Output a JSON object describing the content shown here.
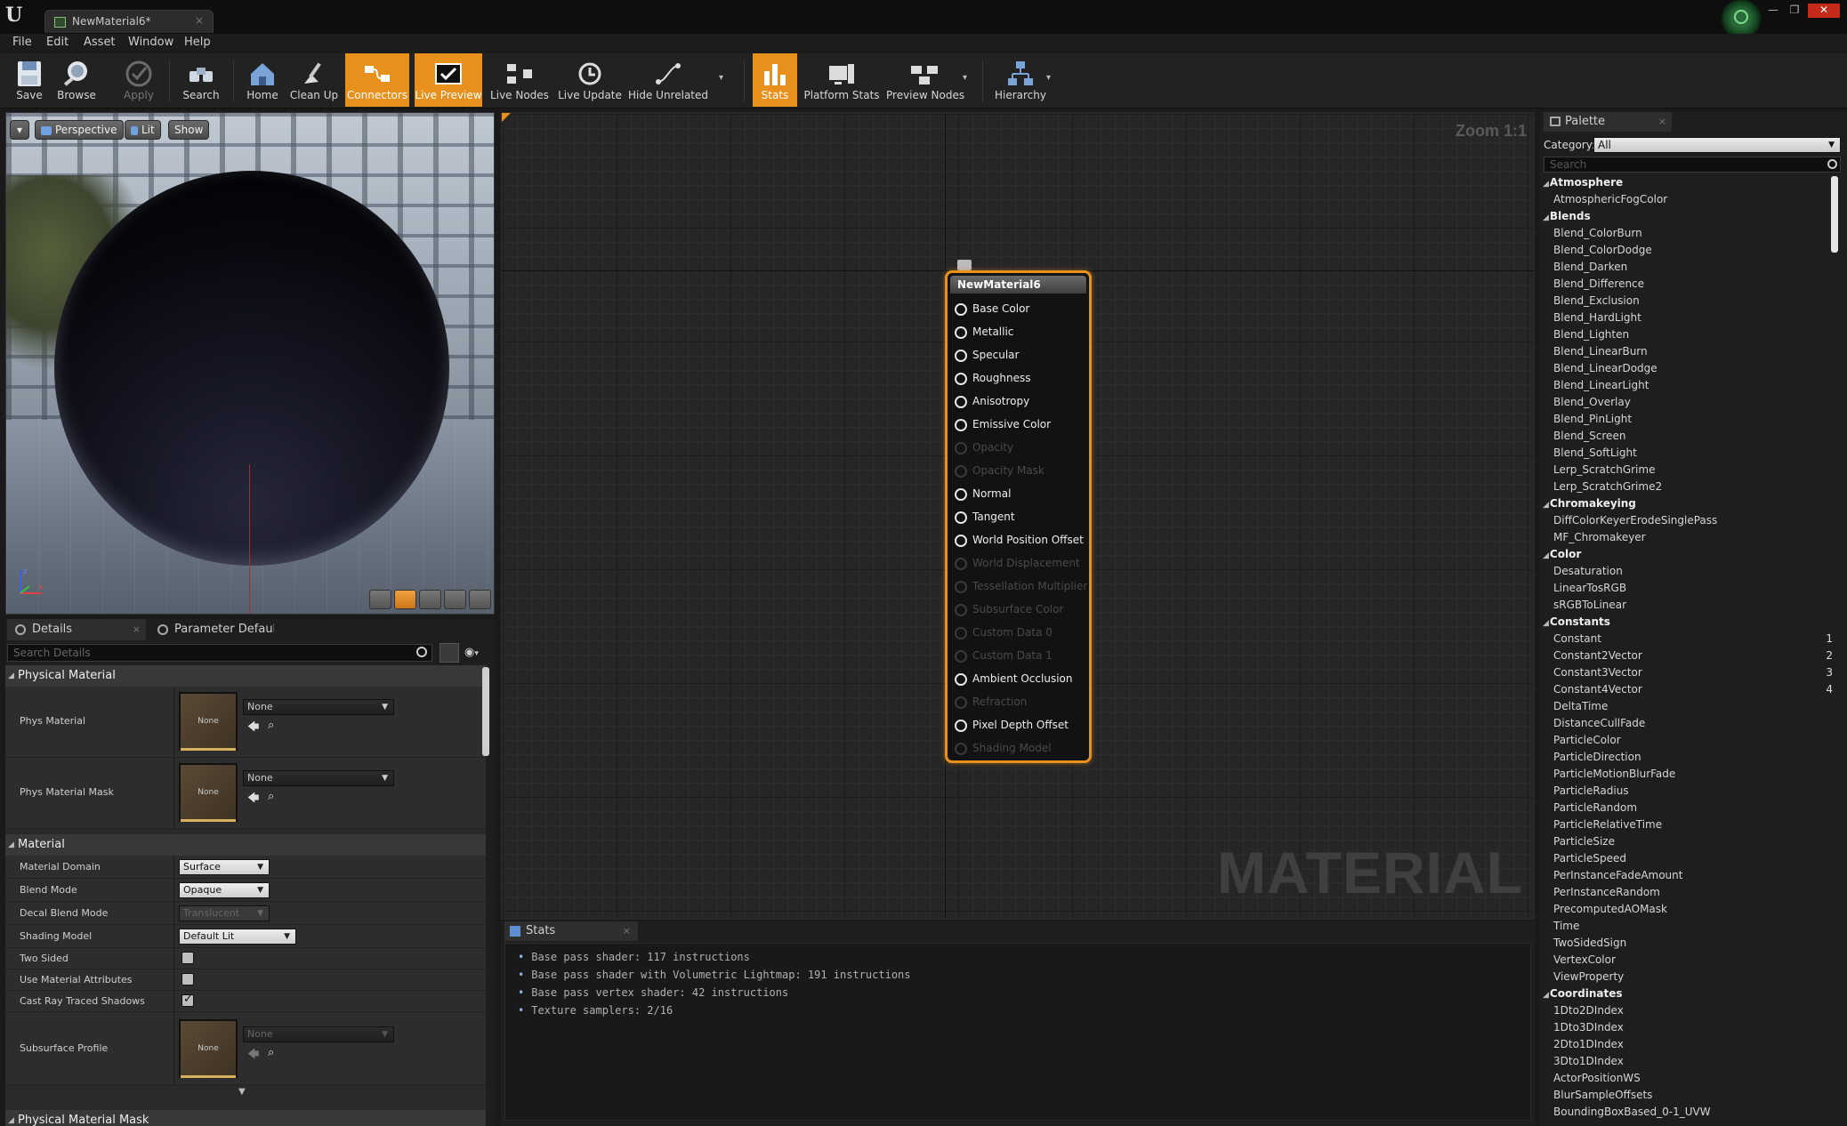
{
  "window": {
    "tab_title": "NewMaterial6*",
    "tab_close": "×",
    "logo": "U",
    "controls": [
      "—",
      "❐",
      "✕"
    ]
  },
  "menu": [
    "File",
    "Edit",
    "Asset",
    "Window",
    "Help"
  ],
  "toolbar": {
    "buttons": [
      {
        "label": "Save",
        "icon": "save-icon",
        "state": "normal"
      },
      {
        "label": "Browse",
        "icon": "browse-icon",
        "state": "normal"
      },
      {
        "label": "Apply",
        "icon": "apply-icon",
        "state": "disabled"
      },
      {
        "label": "Search",
        "icon": "search-icon",
        "state": "normal"
      },
      {
        "label": "Home",
        "icon": "home-icon",
        "state": "normal"
      },
      {
        "label": "Clean Up",
        "icon": "clean-up-icon",
        "state": "normal"
      },
      {
        "label": "Connectors",
        "icon": "connectors-icon",
        "state": "active"
      },
      {
        "label": "Live Preview",
        "icon": "live-preview-icon",
        "state": "active"
      },
      {
        "label": "Live Nodes",
        "icon": "live-nodes-icon",
        "state": "normal"
      },
      {
        "label": "Live Update",
        "icon": "live-update-icon",
        "state": "normal"
      },
      {
        "label": "Hide Unrelated",
        "icon": "hide-unrelated-icon",
        "state": "normal"
      },
      {
        "label": "Stats",
        "icon": "stats-icon",
        "state": "active"
      },
      {
        "label": "Platform Stats",
        "icon": "platform-stats-icon",
        "state": "normal"
      },
      {
        "label": "Preview Nodes",
        "icon": "preview-nodes-icon",
        "state": "normal"
      },
      {
        "label": "Hierarchy",
        "icon": "hierarchy-icon",
        "state": "normal"
      }
    ],
    "dropdown_glyph": "▾"
  },
  "viewport": {
    "view_mode": "Perspective",
    "lighting": "Lit",
    "show": "Show",
    "menu_glyph": "▾",
    "preview_shapes": [
      "cylinder",
      "sphere",
      "plane",
      "cube",
      "custom"
    ],
    "active_shape": "sphere",
    "axis_z": "z",
    "axis_x": "x"
  },
  "details": {
    "tabs": [
      "Details",
      "Parameter Defaults"
    ],
    "search_placeholder": "Search Details",
    "categories": {
      "physical_material": "Physical Material",
      "material": "Material",
      "physical_material_mask": "Physical Material Mask"
    },
    "phys_material": {
      "label": "Phys Material",
      "thumb": "None",
      "value": "None"
    },
    "phys_material_mask": {
      "label": "Phys Material Mask",
      "thumb": "None",
      "value": "None"
    },
    "material_domain": {
      "label": "Material Domain",
      "value": "Surface"
    },
    "blend_mode": {
      "label": "Blend Mode",
      "value": "Opaque"
    },
    "decal_blend_mode": {
      "label": "Decal Blend Mode",
      "value": "Translucent"
    },
    "shading_model": {
      "label": "Shading Model",
      "value": "Default Lit"
    },
    "two_sided": {
      "label": "Two Sided",
      "checked": false
    },
    "use_material_attributes": {
      "label": "Use Material Attributes",
      "checked": false
    },
    "cast_ray_traced_shadows": {
      "label": "Cast Ray Traced Shadows",
      "checked": true
    },
    "subsurface_profile": {
      "label": "Subsurface Profile",
      "thumb": "None",
      "value": "None"
    },
    "back_icon": "🡄",
    "find_icon": "⌕",
    "more_glyph": "▾"
  },
  "graph": {
    "zoom": "Zoom 1:1",
    "watermark": "MATERIAL",
    "node_title": "NewMaterial6",
    "pins": [
      {
        "label": "Base Color",
        "enabled": true
      },
      {
        "label": "Metallic",
        "enabled": true
      },
      {
        "label": "Specular",
        "enabled": true
      },
      {
        "label": "Roughness",
        "enabled": true
      },
      {
        "label": "Anisotropy",
        "enabled": true
      },
      {
        "label": "Emissive Color",
        "enabled": true
      },
      {
        "label": "Opacity",
        "enabled": false
      },
      {
        "label": "Opacity Mask",
        "enabled": false
      },
      {
        "label": "Normal",
        "enabled": true
      },
      {
        "label": "Tangent",
        "enabled": true
      },
      {
        "label": "World Position Offset",
        "enabled": true
      },
      {
        "label": "World Displacement",
        "enabled": false
      },
      {
        "label": "Tessellation Multiplier",
        "enabled": false
      },
      {
        "label": "Subsurface Color",
        "enabled": false
      },
      {
        "label": "Custom Data 0",
        "enabled": false
      },
      {
        "label": "Custom Data 1",
        "enabled": false
      },
      {
        "label": "Ambient Occlusion",
        "enabled": true
      },
      {
        "label": "Refraction",
        "enabled": false
      },
      {
        "label": "Pixel Depth Offset",
        "enabled": true
      },
      {
        "label": "Shading Model",
        "enabled": false
      }
    ]
  },
  "stats": {
    "tab": "Stats",
    "lines": [
      "Base pass shader: 117 instructions",
      "Base pass shader with Volumetric Lightmap: 191 instructions",
      "Base pass vertex shader: 42 instructions",
      "Texture samplers: 2/16"
    ]
  },
  "palette": {
    "tab": "Palette",
    "category_label": "Category:",
    "category_value": "All",
    "search_placeholder": "Search",
    "groups": [
      {
        "name": "Atmosphere",
        "items": [
          {
            "name": "AtmosphericFogColor"
          }
        ]
      },
      {
        "name": "Blends",
        "items": [
          {
            "name": "Blend_ColorBurn"
          },
          {
            "name": "Blend_ColorDodge"
          },
          {
            "name": "Blend_Darken"
          },
          {
            "name": "Blend_Difference"
          },
          {
            "name": "Blend_Exclusion"
          },
          {
            "name": "Blend_HardLight"
          },
          {
            "name": "Blend_Lighten"
          },
          {
            "name": "Blend_LinearBurn"
          },
          {
            "name": "Blend_LinearDodge"
          },
          {
            "name": "Blend_LinearLight"
          },
          {
            "name": "Blend_Overlay"
          },
          {
            "name": "Blend_PinLight"
          },
          {
            "name": "Blend_Screen"
          },
          {
            "name": "Blend_SoftLight"
          },
          {
            "name": "Lerp_ScratchGrime"
          },
          {
            "name": "Lerp_ScratchGrime2"
          }
        ]
      },
      {
        "name": "Chromakeying",
        "items": [
          {
            "name": "DiffColorKeyerErodeSinglePass"
          },
          {
            "name": "MF_Chromakeyer"
          }
        ]
      },
      {
        "name": "Color",
        "items": [
          {
            "name": "Desaturation"
          },
          {
            "name": "LinearTosRGB"
          },
          {
            "name": "sRGBToLinear"
          }
        ]
      },
      {
        "name": "Constants",
        "items": [
          {
            "name": "Constant",
            "hotkey": "1"
          },
          {
            "name": "Constant2Vector",
            "hotkey": "2"
          },
          {
            "name": "Constant3Vector",
            "hotkey": "3"
          },
          {
            "name": "Constant4Vector",
            "hotkey": "4"
          },
          {
            "name": "DeltaTime"
          },
          {
            "name": "DistanceCullFade"
          },
          {
            "name": "ParticleColor"
          },
          {
            "name": "ParticleDirection"
          },
          {
            "name": "ParticleMotionBlurFade"
          },
          {
            "name": "ParticleRadius"
          },
          {
            "name": "ParticleRandom"
          },
          {
            "name": "ParticleRelativeTime"
          },
          {
            "name": "ParticleSize"
          },
          {
            "name": "ParticleSpeed"
          },
          {
            "name": "PerInstanceFadeAmount"
          },
          {
            "name": "PerInstanceRandom"
          },
          {
            "name": "PrecomputedAOMask"
          },
          {
            "name": "Time"
          },
          {
            "name": "TwoSidedSign"
          },
          {
            "name": "VertexColor"
          },
          {
            "name": "ViewProperty"
          }
        ]
      },
      {
        "name": "Coordinates",
        "items": [
          {
            "name": "1Dto2DIndex"
          },
          {
            "name": "1Dto3DIndex"
          },
          {
            "name": "2Dto1DIndex"
          },
          {
            "name": "3Dto1DIndex"
          },
          {
            "name": "ActorPositionWS"
          },
          {
            "name": "BlurSampleOffsets"
          },
          {
            "name": "BoundingBoxBased_0-1_UVW"
          }
        ]
      }
    ]
  }
}
